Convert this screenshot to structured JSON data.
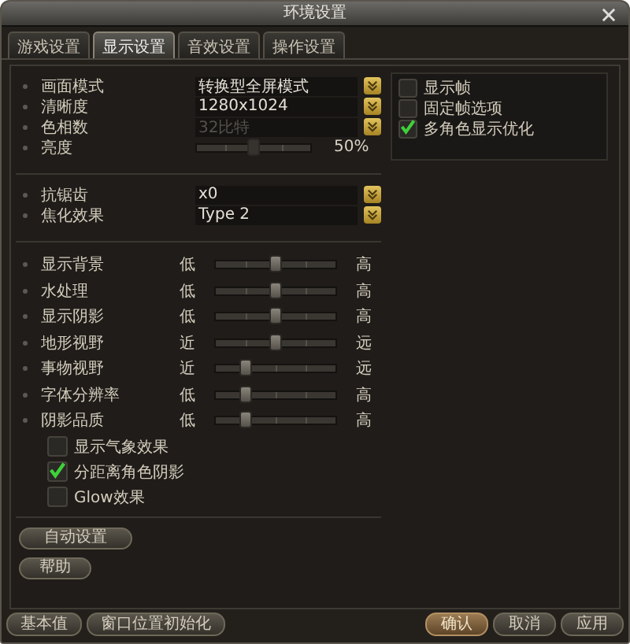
{
  "window": {
    "title": "环境设置"
  },
  "tabs": [
    {
      "label": "游戏设置",
      "selected": false
    },
    {
      "label": "显示设置",
      "selected": true
    },
    {
      "label": "音效设置",
      "selected": false
    },
    {
      "label": "操作设置",
      "selected": false
    }
  ],
  "screen_settings": [
    {
      "kind": "dropdown",
      "label": "画面模式",
      "value": "转换型全屏模式",
      "disabled": false
    },
    {
      "kind": "dropdown",
      "label": "清晰度",
      "value": "1280x1024",
      "disabled": false
    },
    {
      "kind": "dropdown",
      "label": "色相数",
      "value": "32比特",
      "disabled": true
    },
    {
      "kind": "slider",
      "label": "亮度",
      "level": 0.5,
      "reading": "50%"
    }
  ],
  "right_options": [
    {
      "label": "显示帧",
      "checked": false
    },
    {
      "label": "固定帧选项",
      "checked": false
    },
    {
      "label": "多角色显示优化",
      "checked": true
    }
  ],
  "effect_settings": [
    {
      "kind": "dropdown",
      "label": "抗锯齿",
      "value": "x0",
      "disabled": false
    },
    {
      "kind": "dropdown",
      "label": "焦化效果",
      "value": "Type 2",
      "disabled": false
    }
  ],
  "quality_sliders": [
    {
      "label": "显示背景",
      "min_label": "低",
      "max_label": "高",
      "level": 0.5
    },
    {
      "label": "水处理",
      "min_label": "低",
      "max_label": "高",
      "level": 0.5
    },
    {
      "label": "显示阴影",
      "min_label": "低",
      "max_label": "高",
      "level": 0.5
    },
    {
      "label": "地形视野",
      "min_label": "近",
      "max_label": "远",
      "level": 0.5
    },
    {
      "label": "事物视野",
      "min_label": "近",
      "max_label": "远",
      "level": 0.25
    },
    {
      "label": "字体分辨率",
      "min_label": "低",
      "max_label": "高",
      "level": 0.25
    },
    {
      "label": "阴影品质",
      "min_label": "低",
      "max_label": "高",
      "level": 0.25
    }
  ],
  "quality_options": [
    {
      "label": "显示气象效果",
      "checked": false
    },
    {
      "label": "分距离角色阴影",
      "checked": true
    },
    {
      "label": "Glow效果",
      "checked": false
    }
  ],
  "side_buttons": [
    {
      "label": "自动设置",
      "kind": "wide"
    },
    {
      "label": "帮助",
      "kind": "narrow"
    }
  ],
  "footer": {
    "left_buttons": [
      {
        "label": "基本值",
        "highlighted": false
      },
      {
        "label": "窗口位置初始化",
        "highlighted": false
      }
    ],
    "right_buttons": [
      {
        "label": "确认",
        "highlighted": true
      },
      {
        "label": "取消",
        "highlighted": false
      },
      {
        "label": "应用",
        "highlighted": false
      }
    ]
  }
}
